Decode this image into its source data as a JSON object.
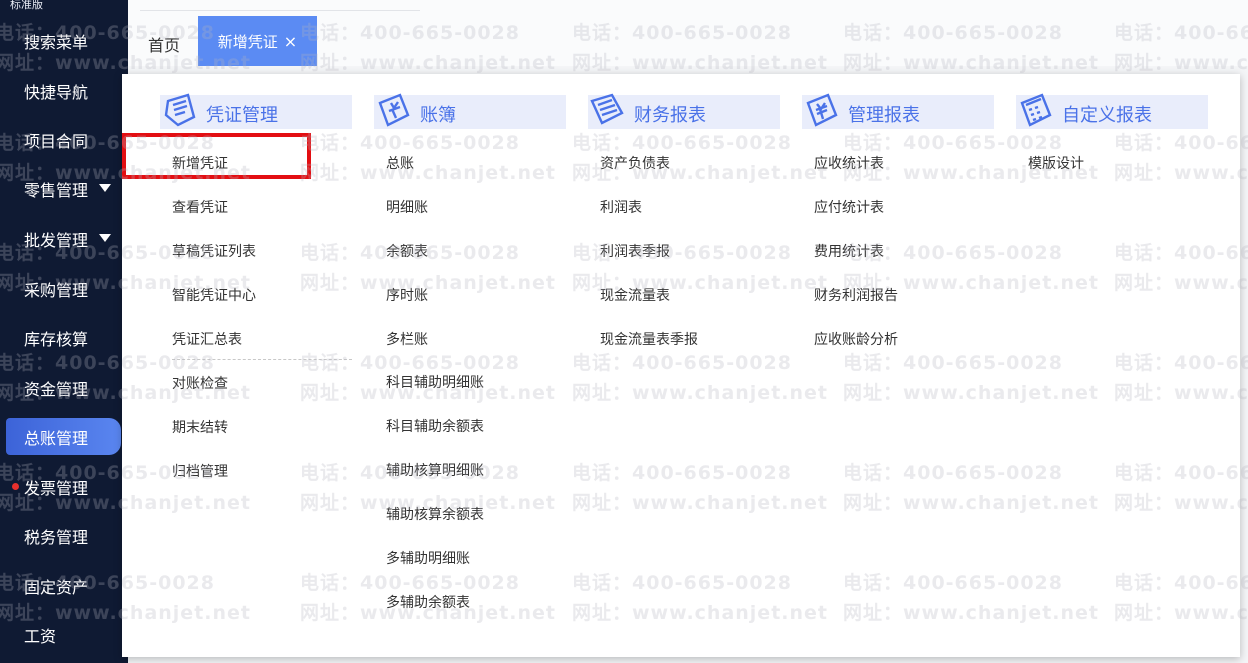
{
  "app": {
    "edition": "标准版"
  },
  "sidebar": {
    "items": [
      {
        "label": "搜索菜单"
      },
      {
        "label": "快捷导航"
      },
      {
        "label": "项目合同"
      },
      {
        "label": "零售管理"
      },
      {
        "label": "批发管理"
      },
      {
        "label": "采购管理"
      },
      {
        "label": "库存核算"
      },
      {
        "label": "资金管理"
      },
      {
        "label": "总账管理"
      },
      {
        "label": "发票管理"
      },
      {
        "label": "税务管理"
      },
      {
        "label": "固定资产"
      },
      {
        "label": "工资"
      }
    ],
    "active": "总账管理"
  },
  "tabs": {
    "home": "首页",
    "active": "新增凭证",
    "close": "×"
  },
  "menu": {
    "columns": [
      {
        "title": "凭证管理",
        "icon": "voucher-icon",
        "items": [
          "新增凭证",
          "查看凭证",
          "草稿凭证列表",
          "智能凭证中心",
          "凭证汇总表",
          "对账检查",
          "期末结转",
          "归档管理"
        ]
      },
      {
        "title": "账簿",
        "icon": "ledger-icon",
        "items": [
          "总账",
          "明细账",
          "余额表",
          "序时账",
          "多栏账",
          "科目辅助明细账",
          "科目辅助余额表",
          "辅助核算明细账",
          "辅助核算余额表",
          "多辅助明细账",
          "多辅助余额表"
        ]
      },
      {
        "title": "财务报表",
        "icon": "financial-report-icon",
        "items": [
          "资产负债表",
          "利润表",
          "利润表季报",
          "现金流量表",
          "现金流量表季报"
        ]
      },
      {
        "title": "管理报表",
        "icon": "management-report-icon",
        "items": [
          "应收统计表",
          "应付统计表",
          "费用统计表",
          "财务利润报告",
          "应收账龄分析"
        ]
      },
      {
        "title": "自定义报表",
        "icon": "custom-report-icon",
        "items": [
          "模版设计"
        ]
      }
    ]
  },
  "watermark": {
    "phone": "电话：400-665-0028",
    "site": "网址：www.chanjet.net"
  },
  "colors": {
    "sidebar_bg": "#0f1a33",
    "accent": "#5b8bf3",
    "highlight": "#e30e12"
  }
}
